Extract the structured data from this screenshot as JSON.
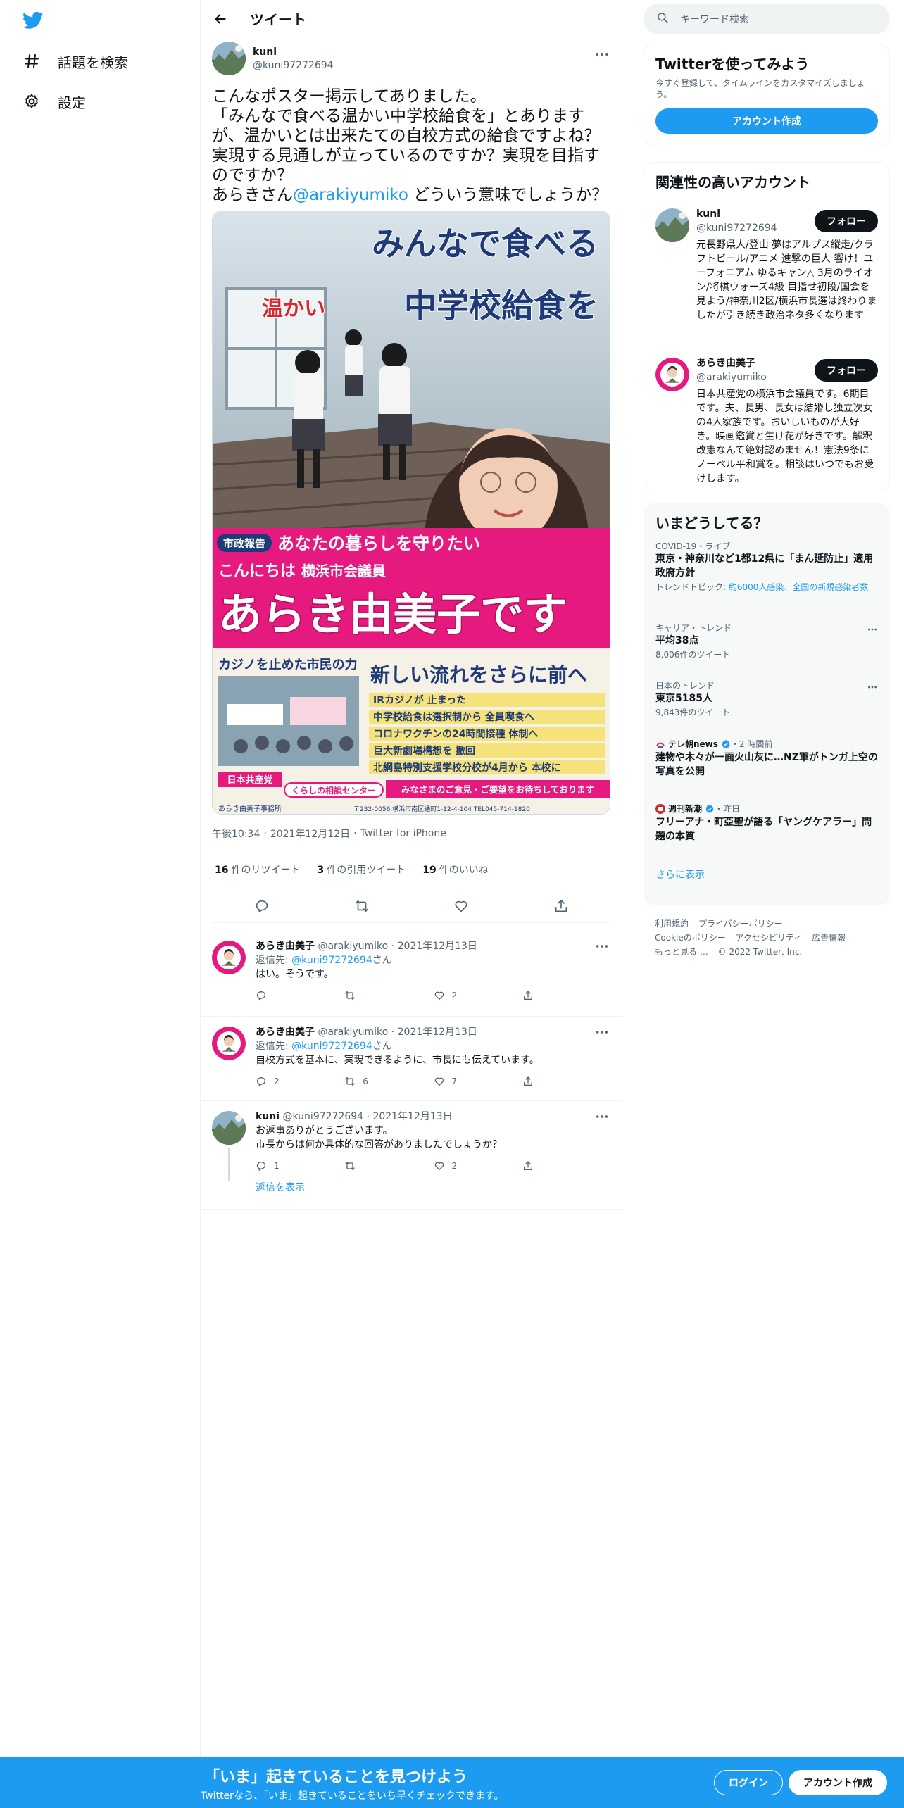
{
  "nav": {
    "explore_label": "話題を検索",
    "settings_label": "設定"
  },
  "header": {
    "title": "ツイート"
  },
  "tweet": {
    "author_name": "kuni",
    "author_handle": "@kuni97272694",
    "text_1": "こんなポスター掲示してありました。",
    "text_2": "「みんなで食べる温かい中学校給食を」とありますが、温かいとは出来たての自校方式の給食ですよね？実現する見通しが立っているのですか？実現を目指すのですか？",
    "text_3a": "あらきさん",
    "text_3_mention": "@arakiyumiko",
    "text_3b": " どういう意味でしょうか？",
    "poster": {
      "headline_1": "みんなで食べる",
      "headline_warm": "温かい",
      "headline_2": "中学校給食を",
      "tag_report": "市政報告",
      "slogan": "あなたの暮らしを守りたい",
      "greeting": "こんにちは",
      "role": "横浜市会議員",
      "name_line": "あらき由美子です",
      "casino_caption": "カジノを止めた市民の力",
      "flow": "新しい流れをさらに前へ",
      "bullets": [
        "IRカジノが 止まった",
        "中学校給食は選択制から 全員喫食へ",
        "コロナワクチンの24時間接種 体制へ",
        "巨大新劇場構想を 撤回",
        "北綱島特別支援学校分校が4月から 本校に"
      ],
      "party": "日本共産党",
      "center": "くらしの相談センター",
      "request": "みなさまのご意見・ご要望をお待ちしております",
      "office": "あらき由美子事務所",
      "address": "〒232-0056 横浜市南区通町1-12-4-104 TEL045-714-1820"
    },
    "time": "午後10:34",
    "date": "2021年12月12日",
    "client": "Twitter for iPhone",
    "retweets_count": "16",
    "retweets_label": "件のリツイート",
    "quotes_count": "3",
    "quotes_label": "件の引用ツイート",
    "likes_count": "19",
    "likes_label": "件のいいね"
  },
  "replies": [
    {
      "name": "あらき由美子",
      "handle": "@arakiyumiko",
      "date": "2021年12月13日",
      "reply_to_label": "返信先: ",
      "reply_to_handle": "@kuni97272694",
      "reply_to_suffix": "さん",
      "text": "はい。そうです。",
      "reply_count": "",
      "retweet_count": "",
      "like_count": "2"
    },
    {
      "name": "あらき由美子",
      "handle": "@arakiyumiko",
      "date": "2021年12月13日",
      "reply_to_label": "返信先: ",
      "reply_to_handle": "@kuni97272694",
      "reply_to_suffix": "さん",
      "text": "自校方式を基本に、実現できるように、市長にも伝えています。",
      "reply_count": "2",
      "retweet_count": "6",
      "like_count": "7"
    },
    {
      "name": "kuni",
      "handle": "@kuni97272694",
      "date": "2021年12月13日",
      "text_1": "お返事ありがとうございます。",
      "text_2": "市長からは何か具体的な回答がありましたでしょうか？",
      "reply_count": "1",
      "retweet_count": "",
      "like_count": "2",
      "show_replies": "返信を表示"
    }
  ],
  "sidebar": {
    "search_placeholder": "キーワード検索",
    "signup_title": "Twitterを使ってみよう",
    "signup_sub": "今すぐ登録して、タイムラインをカスタマイズしましょう。",
    "signup_button": "アカウント作成",
    "relevant_title": "関連性の高いアカウント",
    "follow_label": "フォロー",
    "people": [
      {
        "name": "kuni",
        "handle": "@kuni97272694",
        "bio": "元長野県人/登山 夢はアルプス縦走/クラフトビール/アニメ 進撃の巨人 響け！ユーフォニアム ゆるキャン△ 3月のライオン/将棋ウォーズ4級 目指せ初段/国会を見よう/神奈川2区/横浜市長選は終わりましたが引き続き政治ネタ多くなります"
      },
      {
        "name": "あらき由美子",
        "handle": "@arakiyumiko",
        "bio": "日本共産党の横浜市会議員です。6期目です。夫、長男、長女は結婚し独立次女の4人家族です。おいしいものが大好き。映画鑑賞と生け花が好きです。解釈改憲なんて絶対認めません！憲法9条にノーベル平和賞を。相談はいつでもお受けします。"
      }
    ],
    "trends_title": "いまどうしてる？",
    "trends": [
      {
        "meta": "COVID-19・ライブ",
        "name": "東京・神奈川など1都12県に「まん延防止」適用 政府方針",
        "sub_prefix": "トレンドトピック: ",
        "sub_link": "約6000人感染、全国の新規感染者数"
      },
      {
        "meta": "キャリア・トレンド",
        "name": "平均38点",
        "sub": "8,006件のツイート"
      },
      {
        "meta": "日本のトレンド",
        "name": "東京5185人",
        "sub": "9,843件のツイート"
      },
      {
        "source": "テレ朝news",
        "time": "・2 時間前",
        "name": "建物や木々が一面火山灰に…NZ軍がトンガ上空の写真を公開"
      },
      {
        "source": "週刊新潮",
        "time": "・昨日",
        "name": "フリーアナ・町亞聖が語る「ヤングケアラー」問題の本質"
      }
    ],
    "show_more": "さらに表示",
    "footer_links": [
      "利用規約",
      "プライバシーポリシー",
      "Cookieのポリシー",
      "アクセシビリティ",
      "広告情報",
      "もっと見る …",
      "© 2022 Twitter, Inc."
    ]
  },
  "bottom_bar": {
    "title": "「いま」起きていることを見つけよう",
    "sub": "Twitterなら、「いま」起きていることをいち早くチェックできます。",
    "login": "ログイン",
    "signup": "アカウント作成"
  },
  "colors": {
    "accent": "#1d9bf0",
    "text": "#0f1419",
    "secondary": "#536471",
    "poster_pink": "#e6197f",
    "poster_navy": "#1e3a78"
  }
}
